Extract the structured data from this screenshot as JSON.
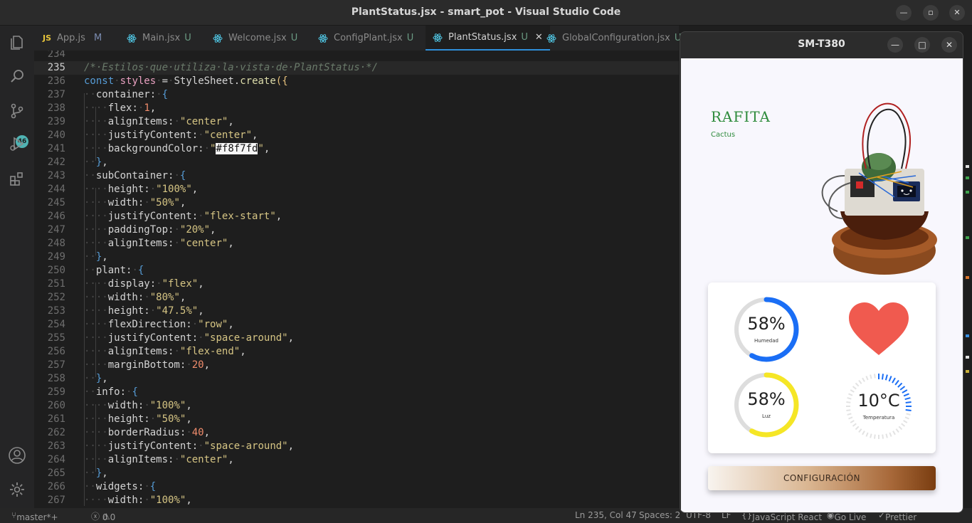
{
  "window": {
    "title": "PlantStatus.jsx - smart_pot - Visual Studio Code"
  },
  "activity": {
    "source_control_badge": "46"
  },
  "tabs": [
    {
      "label": "App.js",
      "status": "M",
      "icon": "js-icon"
    },
    {
      "label": "Main.jsx",
      "status": "U",
      "icon": "react-icon"
    },
    {
      "label": "Welcome.jsx",
      "status": "U",
      "icon": "react-icon"
    },
    {
      "label": "ConfigPlant.jsx",
      "status": "U",
      "icon": "react-icon"
    },
    {
      "label": "PlantStatus.jsx",
      "status": "U",
      "icon": "react-icon",
      "active": true
    },
    {
      "label": "GlobalConfiguration.jsx",
      "status": "U",
      "icon": "react-icon"
    }
  ],
  "editor": {
    "line_numbers": [
      "234",
      "235",
      "236",
      "237",
      "238",
      "239",
      "240",
      "241",
      "242",
      "243",
      "244",
      "245",
      "246",
      "247",
      "248",
      "249",
      "250",
      "251",
      "252",
      "253",
      "254",
      "255",
      "256",
      "257",
      "258",
      "259",
      "260",
      "261",
      "262",
      "263",
      "264",
      "265",
      "266",
      "267"
    ],
    "comment": "/*·Estilos·que·utiliza·la·vista·de·PlantStatus·*/",
    "highlight_value": "#f8f7fd"
  },
  "statusbar": {
    "branch": "master*+",
    "errors": "0",
    "warnings": "0",
    "position": "Ln 235, Col 47",
    "spaces": "Spaces: 2",
    "encoding": "UTF-8",
    "eol": "LF",
    "language": "JavaScript React",
    "golive": "Go Live",
    "prettier": "Prettier"
  },
  "emulator": {
    "title": "SM-T380",
    "plant_name": "RAFITA",
    "plant_type": "Cactus",
    "humidity": {
      "value": "58%",
      "label": "Humedad",
      "level": 0.58,
      "color": "#1a6ef5"
    },
    "light": {
      "value": "58%",
      "label": "Luz",
      "level": 0.58,
      "color": "#f5e626"
    },
    "temperature": {
      "value": "10°C",
      "label": "Temperatura",
      "color": "#1a6ef5"
    },
    "heart_color": "#f05a4f",
    "config_button": "CONFIGURACIÓN"
  }
}
